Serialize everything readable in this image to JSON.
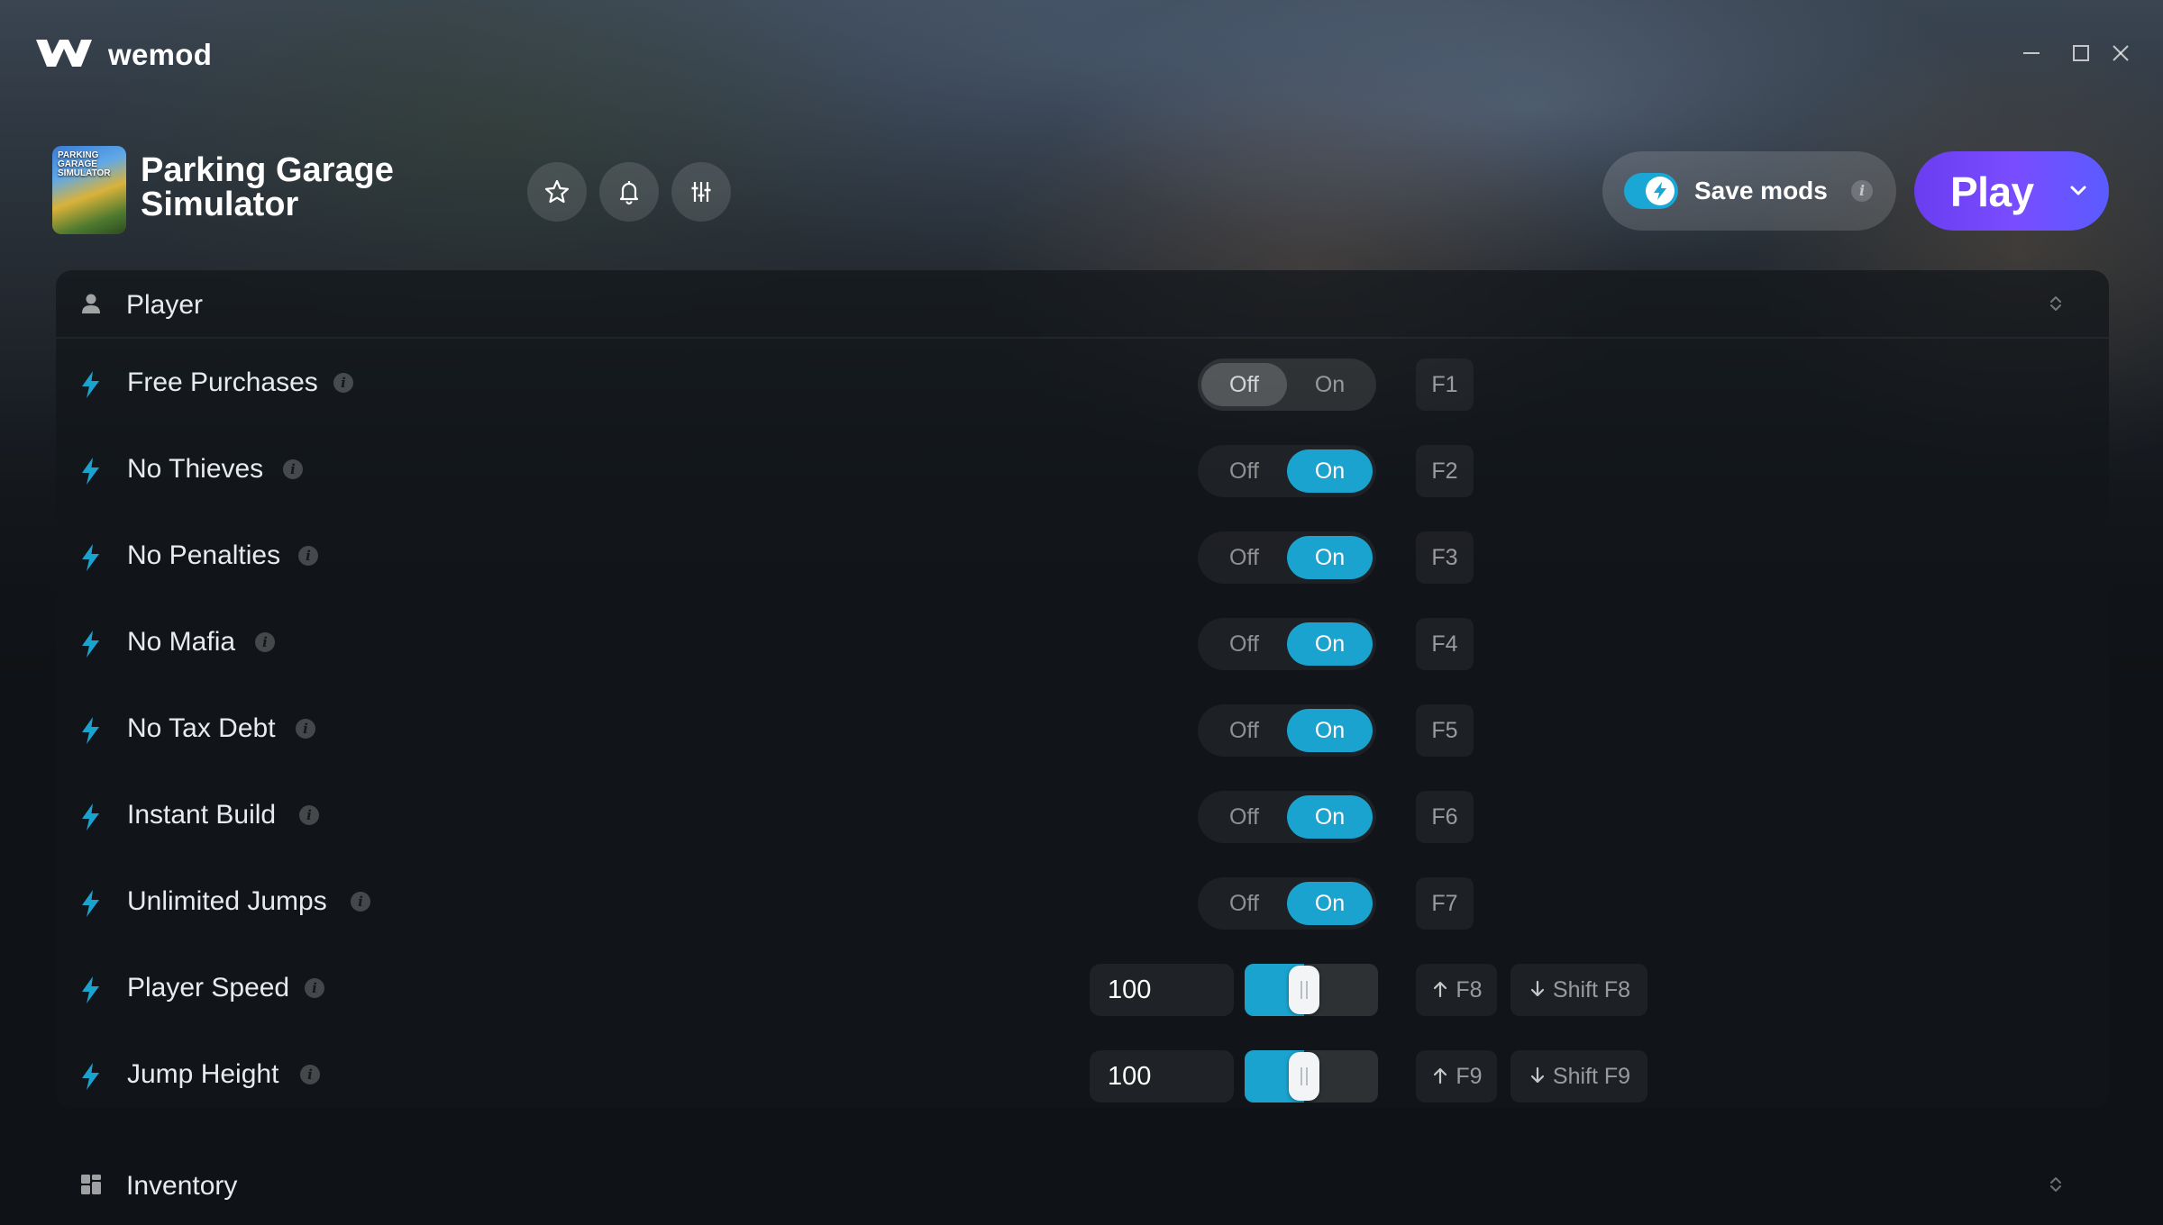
{
  "app": {
    "brand": "wemod"
  },
  "game": {
    "title_line1": "Parking Garage",
    "title_line2": "Simulator",
    "thumb_text": "PARKING GARAGE SIMULATOR"
  },
  "header": {
    "save_mods_label": "Save mods",
    "save_mods_enabled": true,
    "save_mods_info": "i",
    "play_label": "Play"
  },
  "categories": [
    {
      "label": "Player",
      "icon": "person-icon"
    },
    {
      "label": "Inventory",
      "icon": "grid-icon"
    }
  ],
  "mods": [
    {
      "label": "Free Purchases",
      "type": "toggle",
      "state": "Off",
      "off": "Off",
      "on": "On",
      "hotkey": "F1"
    },
    {
      "label": "No Thieves",
      "type": "toggle",
      "state": "On",
      "off": "Off",
      "on": "On",
      "hotkey": "F2"
    },
    {
      "label": "No Penalties",
      "type": "toggle",
      "state": "On",
      "off": "Off",
      "on": "On",
      "hotkey": "F3"
    },
    {
      "label": "No Mafia",
      "type": "toggle",
      "state": "On",
      "off": "Off",
      "on": "On",
      "hotkey": "F4"
    },
    {
      "label": "No Tax Debt",
      "type": "toggle",
      "state": "On",
      "off": "Off",
      "on": "On",
      "hotkey": "F5"
    },
    {
      "label": "Instant Build",
      "type": "toggle",
      "state": "On",
      "off": "Off",
      "on": "On",
      "hotkey": "F6"
    },
    {
      "label": "Unlimited Jumps",
      "type": "toggle",
      "state": "On",
      "off": "Off",
      "on": "On",
      "hotkey": "F7"
    },
    {
      "label": "Player Speed",
      "type": "slider",
      "value": "100",
      "level": 0.33,
      "hotkey_up": "F8",
      "hotkey_down": "Shift F8"
    },
    {
      "label": "Jump Height",
      "type": "slider",
      "value": "100",
      "level": 0.33,
      "hotkey_up": "F9",
      "hotkey_down": "Shift F9"
    }
  ],
  "colors": {
    "accent": "#1aa3cf",
    "play": "#7a4cff",
    "background": "#0f1216"
  }
}
